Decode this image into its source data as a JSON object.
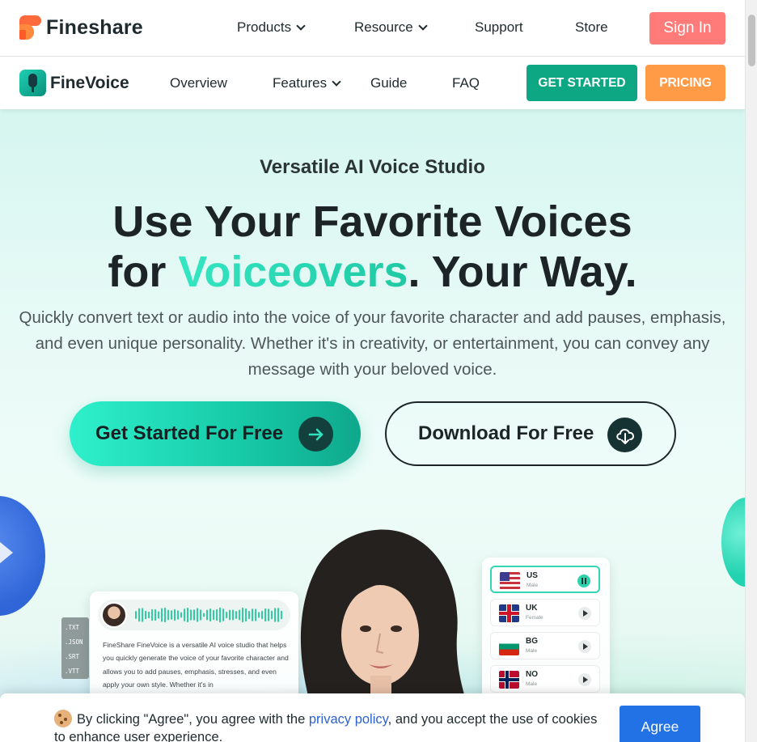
{
  "top_nav": {
    "brand": "Fineshare",
    "menu": [
      {
        "label": "Products",
        "dropdown": true
      },
      {
        "label": "Resource",
        "dropdown": true
      },
      {
        "label": "Support",
        "dropdown": false
      },
      {
        "label": "Store",
        "dropdown": false
      }
    ],
    "sign_in": "Sign In"
  },
  "sub_nav": {
    "product_name": "FineVoice",
    "menu": [
      {
        "label": "Overview"
      },
      {
        "label": "Features",
        "dropdown": true
      },
      {
        "label": "Guide"
      },
      {
        "label": "FAQ"
      }
    ],
    "get_started": "GET STARTED",
    "pricing": "PRICING"
  },
  "hero": {
    "tagline": "Versatile AI Voice Studio",
    "headline_line1": "Use Your Favorite Voices",
    "headline_for": "for ",
    "headline_accent": "Voiceovers",
    "headline_rest": ". Your Way.",
    "subtext": "Quickly convert text or audio into the voice of your favorite character and add pauses, emphasis, and even unique personality. Whether it's in creativity, or entertainment, you can convey any message with your beloved voice.",
    "cta_primary": "Get Started For Free",
    "cta_secondary": "Download For Free"
  },
  "illustration": {
    "formats": [
      ".TXT",
      ".JSON",
      ".SRT",
      ".VTT"
    ],
    "card_text": "FineShare FineVoice is a versatile AI voice studio that helps you quickly generate the voice of your favorite character and allows you to add pauses, emphasis, stresses, and even apply your own style. Whether it's in",
    "languages": [
      {
        "code": "US",
        "gender": "Male",
        "active": true
      },
      {
        "code": "UK",
        "gender": "Female",
        "active": false
      },
      {
        "code": "BG",
        "gender": "Male",
        "active": false
      },
      {
        "code": "NO",
        "gender": "Male",
        "active": false
      }
    ]
  },
  "cookie_banner": {
    "text_before": "By clicking \"Agree\", you agree with the ",
    "link": "privacy policy",
    "text_after": ", and you accept the use of cookies to enhance user experience.",
    "agree": "Agree"
  },
  "colors": {
    "brand_orange": "#ff6a3d",
    "sign_in": "#ff7b79",
    "get_started": "#0da883",
    "pricing": "#ff9b47",
    "accent_teal": "#1fc9a4",
    "agree_blue": "#2272e6"
  }
}
